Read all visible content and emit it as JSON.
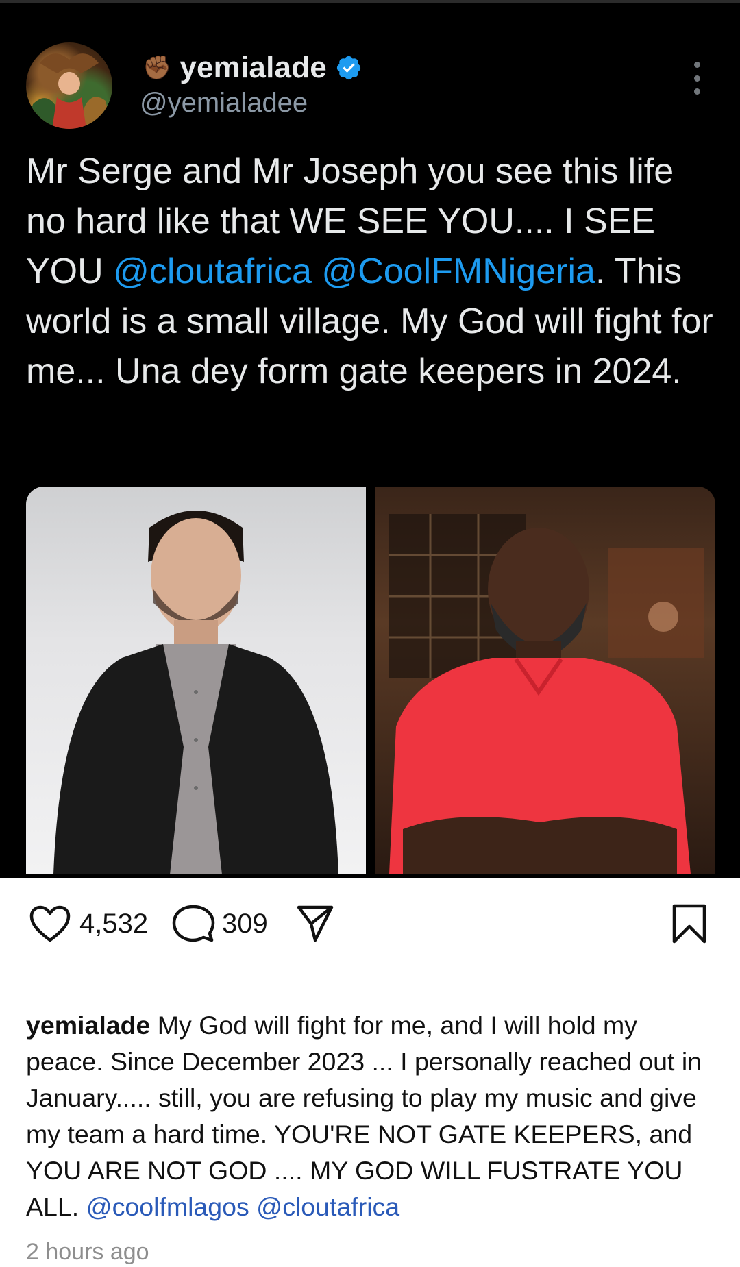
{
  "tweet": {
    "display_name": "yemialade",
    "handle": "@yemialadee",
    "status_emoji": "✊🏾",
    "text_part1": "Mr Serge and Mr Joseph you see this life no hard like that WE SEE YOU.... I SEE YOU ",
    "mention1": "@cloutafrica",
    "mention2": "@CoolFMNigeria",
    "text_part2": ". This world is a small village. My God will fight for me... Una dey form gate keepers in 2024.",
    "icons": {
      "verified": "verified-badge-icon",
      "more": "more-options-icon",
      "status": "raised-fist-icon"
    },
    "colors": {
      "link": "#1d9bf0",
      "verified": "#1d9bf0",
      "background": "#000000"
    }
  },
  "post": {
    "likes": "4,532",
    "comments": "309",
    "icons": {
      "like": "heart-icon",
      "comment": "comment-icon",
      "share": "share-icon",
      "save": "bookmark-icon"
    },
    "caption": {
      "username": "yemialade",
      "text": " My God will fight for me, and I will hold my peace. Since December 2023 ... I personally reached out in January..... still, you are refusing to play my music and give my team a hard time. YOU'RE NOT GATE KEEPERS, and YOU ARE NOT GOD .... MY GOD WILL FUSTRATE YOU ALL. ",
      "tag1": "@coolfmlagos",
      "tag2": "@cloutafrica"
    },
    "timestamp": "2 hours ago"
  }
}
